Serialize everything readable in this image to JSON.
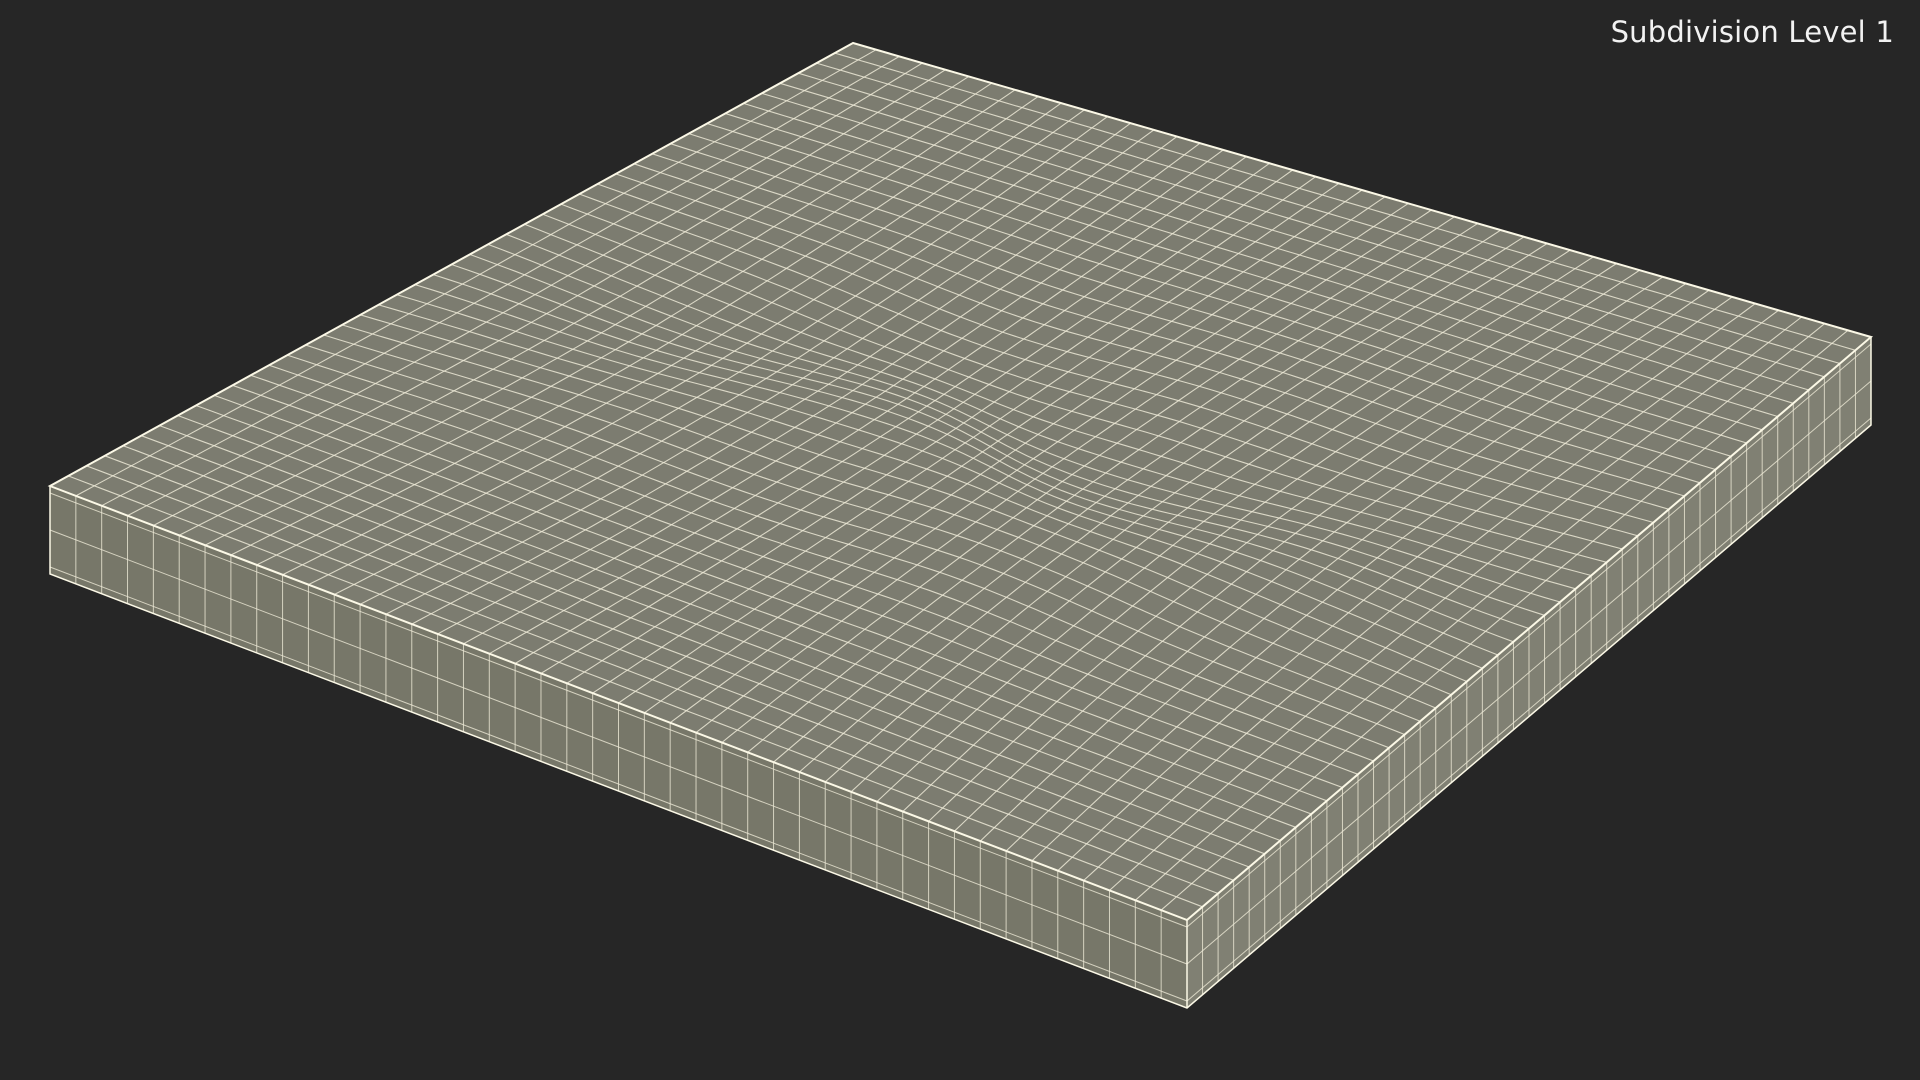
{
  "overlay": {
    "label": "Subdivision Level 1"
  },
  "colors": {
    "background": "#262626",
    "top_face": "#7c7c70",
    "front_face": "#777769",
    "right_face": "#808073",
    "wire": "#ece9d6",
    "edge_highlight": "#fbf8e6",
    "label_text": "#f2f2f2"
  }
}
